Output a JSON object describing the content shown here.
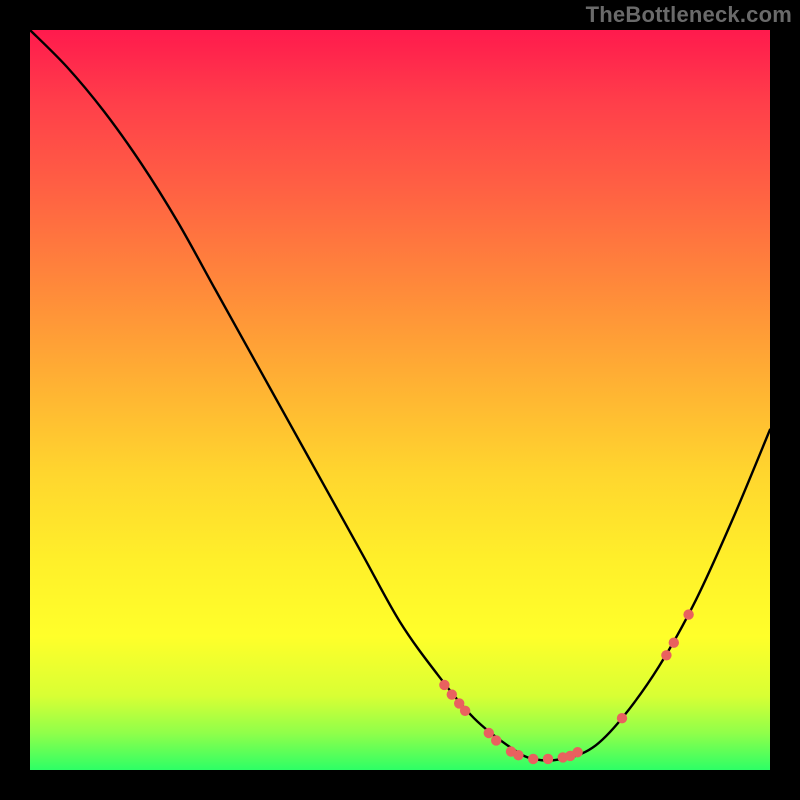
{
  "watermark": "TheBottleneck.com",
  "chart_data": {
    "type": "line",
    "title": "",
    "xlabel": "",
    "ylabel": "",
    "xlim": [
      0,
      100
    ],
    "ylim": [
      0,
      100
    ],
    "x": [
      0,
      5,
      10,
      15,
      20,
      25,
      30,
      35,
      40,
      45,
      50,
      55,
      60,
      65,
      68,
      72,
      76,
      80,
      85,
      90,
      95,
      100
    ],
    "values": [
      100,
      95,
      89,
      82,
      74,
      65,
      56,
      47,
      38,
      29,
      20,
      13,
      7,
      3,
      1.5,
      1.5,
      3,
      7,
      14,
      23,
      34,
      46
    ],
    "markers": [
      {
        "x": 56,
        "y": 11.5
      },
      {
        "x": 57,
        "y": 10.2
      },
      {
        "x": 58,
        "y": 9.0
      },
      {
        "x": 58.8,
        "y": 8.0
      },
      {
        "x": 62,
        "y": 5.0
      },
      {
        "x": 63,
        "y": 4.0
      },
      {
        "x": 65,
        "y": 2.5
      },
      {
        "x": 66,
        "y": 2.0
      },
      {
        "x": 68,
        "y": 1.5
      },
      {
        "x": 70,
        "y": 1.5
      },
      {
        "x": 72,
        "y": 1.7
      },
      {
        "x": 73,
        "y": 1.9
      },
      {
        "x": 74,
        "y": 2.4
      },
      {
        "x": 80,
        "y": 7.0
      },
      {
        "x": 86,
        "y": 15.5
      },
      {
        "x": 87,
        "y": 17.2
      },
      {
        "x": 89,
        "y": 21.0
      }
    ],
    "marker_color": "#e9615f",
    "curve_color": "#000000"
  }
}
